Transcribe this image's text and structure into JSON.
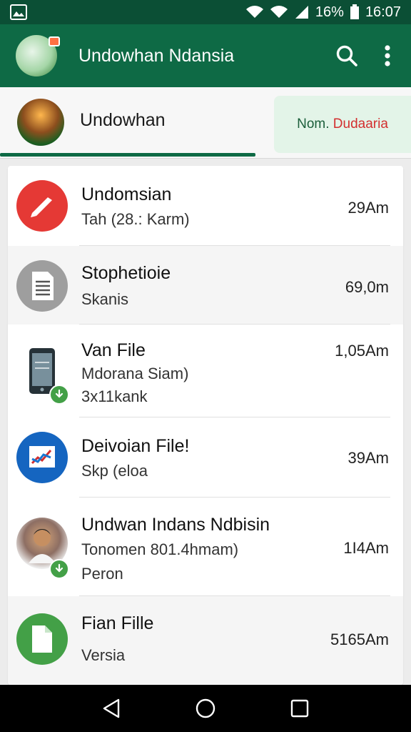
{
  "status_bar": {
    "battery": "16%",
    "time": "16:07",
    "icons": [
      "image-icon",
      "wifi-icon",
      "wifi-icon",
      "signal-icon",
      "battery-icon"
    ]
  },
  "app_bar": {
    "title": "Undowhan Ndansia",
    "actions": [
      "search-icon",
      "more-vert-icon"
    ]
  },
  "account": {
    "name": "Undowhan",
    "tab_label_part1": "Nom.",
    "tab_label_part2": "Dudaaria"
  },
  "list": {
    "items": [
      {
        "title": "Undomsian",
        "subtitle": "Tah (28.: Karm)",
        "time": "29Am",
        "icon": "pen-icon",
        "color": "#e53935"
      },
      {
        "title": "Stophetioie",
        "subtitle": "Skanis",
        "time": "69,0m",
        "icon": "document-icon",
        "color": "#9e9e9e"
      },
      {
        "title": "Van File",
        "subtitle": "Mdorana Siam)",
        "subtitle2": "3x11kank",
        "time": "1,05Am",
        "icon": "phone-icon",
        "color": "#2e7d32"
      },
      {
        "title": "Deivoian File!",
        "subtitle": "Skp (eloa",
        "time": "39Am",
        "icon": "chart-icon",
        "color": "#1565c0"
      },
      {
        "title": "Undwan Indans Ndbisin",
        "subtitle": "Tonomen 801.4hmam)",
        "subtitle2": "Peron",
        "time": "1I4Am",
        "icon": "person-avatar",
        "color": "#8d6e63"
      },
      {
        "title": "Fian Fille",
        "subtitle": "Versia",
        "time": "5165Am",
        "icon": "file-icon",
        "color": "#43a047"
      }
    ]
  },
  "nav_bar": {
    "buttons": [
      "back-icon",
      "home-icon",
      "recents-icon"
    ]
  }
}
